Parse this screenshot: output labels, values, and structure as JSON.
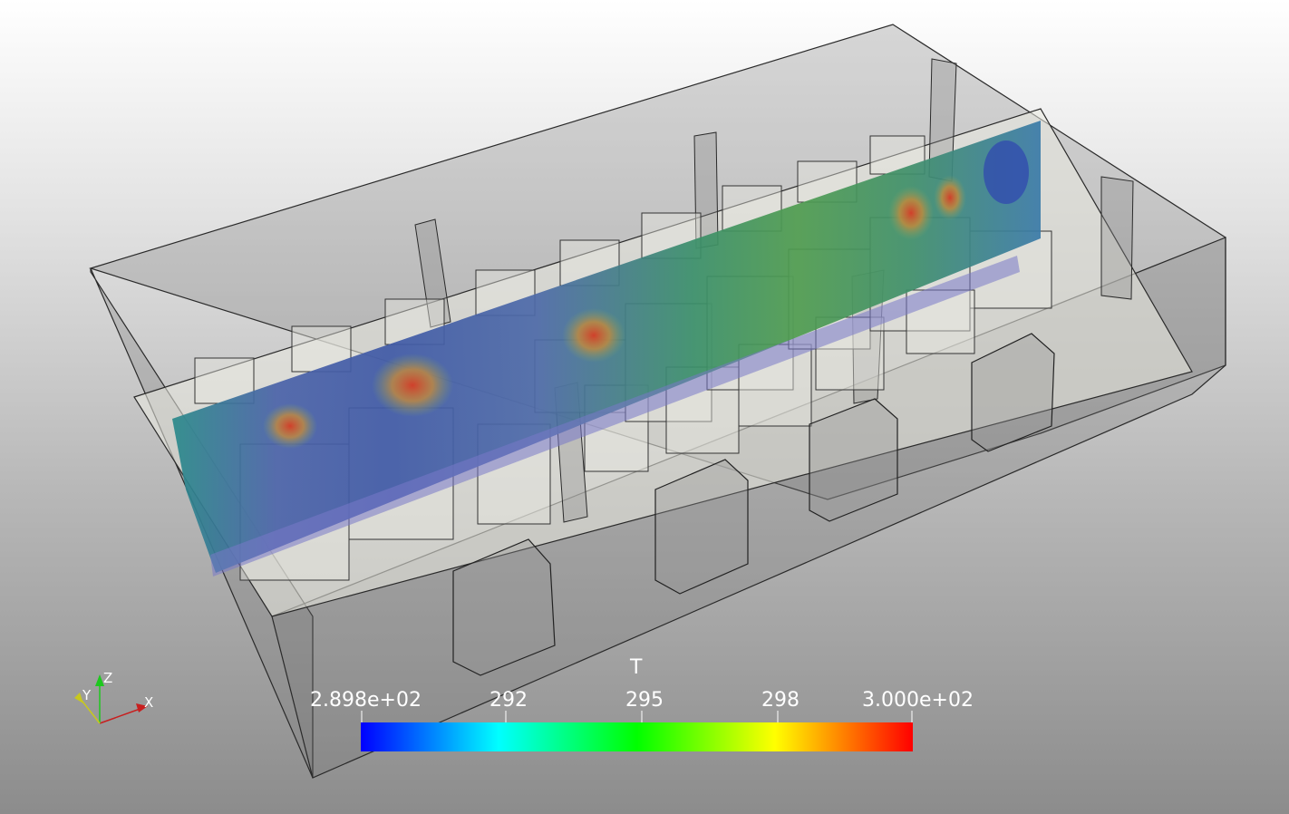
{
  "colorbar": {
    "title": "T",
    "ticks": [
      "2.898e+02",
      "292",
      "295",
      "298",
      "3.000e+02"
    ],
    "range": [
      289.8,
      300.0
    ],
    "colormap": [
      "#0000ff",
      "#00ffff",
      "#00ff00",
      "#ffff00",
      "#ff0000"
    ]
  },
  "orientation_axes": {
    "x_label": "X",
    "y_label": "Y",
    "z_label": "Z"
  },
  "colors": {
    "background_top": "#ffffff",
    "background_bottom": "#8c8c8c",
    "slice_hot": "#c0392b",
    "slice_cool": "#3f55a5"
  }
}
